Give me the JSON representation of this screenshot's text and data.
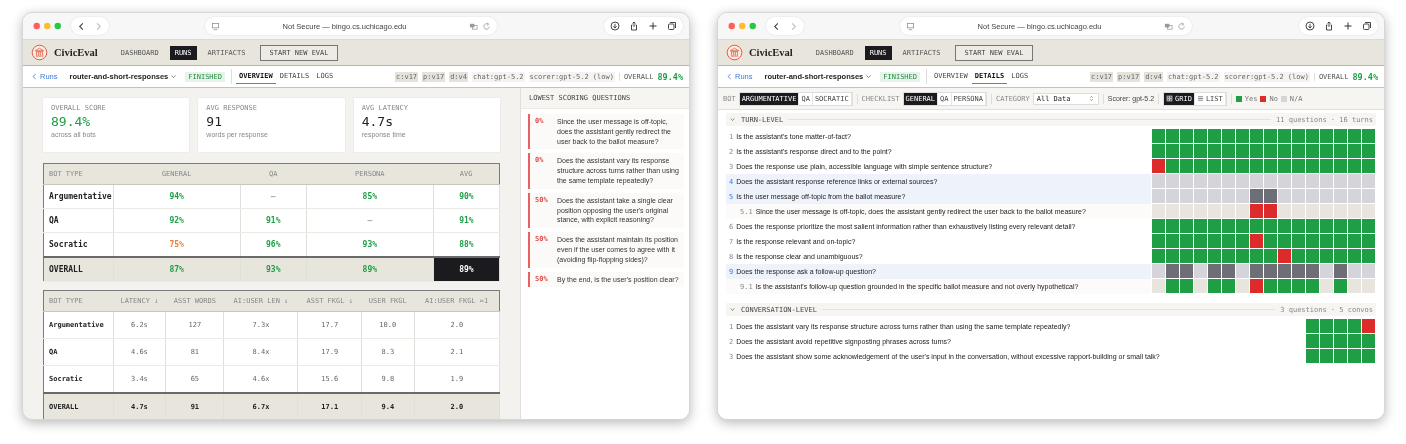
{
  "windows": [
    {
      "kind": "overview",
      "address": "Not Secure — bingo.cs.uchicago.edu",
      "logo": "CivicEval",
      "nav": [
        {
          "label": "DASHBOARD",
          "selected": false
        },
        {
          "label": "RUNS",
          "selected": true
        },
        {
          "label": "ARTIFACTS",
          "selected": false
        }
      ],
      "new_eval": "START NEW EVAL",
      "run": {
        "back": "Runs",
        "name": "router-and-short-responses",
        "status": "FINISHED",
        "tabs": [
          {
            "label": "OVERVIEW",
            "selected": true
          },
          {
            "label": "DETAILS",
            "selected": false
          },
          {
            "label": "LOGS",
            "selected": false
          }
        ],
        "tags": [
          {
            "text": "c:v17",
            "kind": "version"
          },
          {
            "text": "p:v17",
            "kind": "version"
          },
          {
            "text": "d:v4",
            "kind": "version"
          },
          {
            "text": "chat:gpt-5.2",
            "kind": "model"
          },
          {
            "text": "scorer:gpt-5.2 (low)",
            "kind": "model"
          }
        ],
        "overall_label": "OVERALL",
        "overall_value": "89.4%"
      },
      "stats": [
        {
          "label": "OVERALL SCORE",
          "value": "89.4%",
          "note": "across all bots",
          "color": "#1f9e45"
        },
        {
          "label": "AVG RESPONSE",
          "value": "91",
          "note": "words per response",
          "color": "#222222"
        },
        {
          "label": "AVG LATENCY",
          "value": "4.7s",
          "note": "response time",
          "color": "#222222"
        }
      ],
      "score_table": {
        "columns": [
          "BOT TYPE",
          "GENERAL",
          "QA",
          "PERSONA",
          "AVG"
        ],
        "rows": [
          {
            "kind": "bot",
            "cells": [
              {
                "text": "Argumentative",
                "color": "#222222",
                "highlighted": false
              },
              {
                "text": "94%",
                "color": "#1f9e45",
                "highlighted": false
              },
              {
                "text": "—",
                "color": "#aaaaaa",
                "highlighted": false
              },
              {
                "text": "85%",
                "color": "#1f9e45",
                "highlighted": false
              },
              {
                "text": "90%",
                "color": "#1f9e45",
                "highlighted": false
              }
            ]
          },
          {
            "kind": "bot",
            "cells": [
              {
                "text": "QA",
                "color": "#222222",
                "highlighted": false
              },
              {
                "text": "92%",
                "color": "#1f9e45",
                "highlighted": false
              },
              {
                "text": "91%",
                "color": "#1f9e45",
                "highlighted": false
              },
              {
                "text": "—",
                "color": "#aaaaaa",
                "highlighted": false
              },
              {
                "text": "91%",
                "color": "#1f9e45",
                "highlighted": false
              }
            ]
          },
          {
            "kind": "bot",
            "cells": [
              {
                "text": "Socratic",
                "color": "#222222",
                "highlighted": false
              },
              {
                "text": "75%",
                "color": "#e8823a",
                "highlighted": false
              },
              {
                "text": "96%",
                "color": "#1f9e45",
                "highlighted": false
              },
              {
                "text": "93%",
                "color": "#1f9e45",
                "highlighted": false
              },
              {
                "text": "88%",
                "color": "#1f9e45",
                "highlighted": false
              }
            ]
          },
          {
            "kind": "total",
            "cells": [
              {
                "text": "OVERALL",
                "color": "#222222",
                "highlighted": false
              },
              {
                "text": "87%",
                "color": "#1f9e45",
                "highlighted": false
              },
              {
                "text": "93%",
                "color": "#1f9e45",
                "highlighted": false
              },
              {
                "text": "89%",
                "color": "#1f9e45",
                "highlighted": false
              },
              {
                "text": "89%",
                "color": "#ffffff",
                "highlighted": true
              }
            ]
          }
        ]
      },
      "metrics_table": {
        "columns": [
          "BOT TYPE",
          "LATENCY ↓",
          "ASST WORDS",
          "AI:USER LEN ↓",
          "ASST FKGL ↓",
          "USER FKGL",
          "AI:USER FKGL ≈1"
        ],
        "rows": [
          {
            "kind": "bot",
            "cells": [
              "Argumentative",
              "6.2s",
              "127",
              "7.3x",
              "17.7",
              "10.0",
              "2.0"
            ]
          },
          {
            "kind": "bot",
            "cells": [
              "QA",
              "4.6s",
              "81",
              "8.4x",
              "17.9",
              "8.3",
              "2.1"
            ]
          },
          {
            "kind": "bot",
            "cells": [
              "Socratic",
              "3.4s",
              "65",
              "4.6x",
              "15.6",
              "9.8",
              "1.9"
            ]
          },
          {
            "kind": "total",
            "cells": [
              "OVERALL",
              "4.7s",
              "91",
              "6.7x",
              "17.1",
              "9.4",
              "2.0"
            ]
          }
        ]
      },
      "lowest": {
        "title": "LOWEST SCORING QUESTIONS",
        "items": [
          {
            "score": "0%",
            "text": "Since the user message is off-topic, does the assistant gently redirect the user back to the ballot measure?"
          },
          {
            "score": "0%",
            "text": "Does the assistant vary its response structure across turns rather than using the same template repeatedly?"
          },
          {
            "score": "50%",
            "text": "Does the assistant take a single clear position opposing the user's original stance, with explicit reasoning?"
          },
          {
            "score": "50%",
            "text": "Does the assistant maintain its position even if the user comes to agree with it (avoiding flip-flopping sides)?"
          },
          {
            "score": "50%",
            "text": "By the end, is the user's position clear?"
          }
        ]
      }
    },
    {
      "kind": "details",
      "address": "Not Secure — bingo.cs.uchicago.edu",
      "logo": "CivicEval",
      "nav": [
        {
          "label": "DASHBOARD",
          "selected": false
        },
        {
          "label": "RUNS",
          "selected": true
        },
        {
          "label": "ARTIFACTS",
          "selected": false
        }
      ],
      "new_eval": "START NEW EVAL",
      "run": {
        "back": "Runs",
        "name": "router-and-short-responses",
        "status": "FINISHED",
        "tabs": [
          {
            "label": "OVERVIEW",
            "selected": false
          },
          {
            "label": "DETAILS",
            "selected": true
          },
          {
            "label": "LOGS",
            "selected": false
          }
        ],
        "tags": [
          {
            "text": "c:v17",
            "kind": "version"
          },
          {
            "text": "p:v17",
            "kind": "version"
          },
          {
            "text": "d:v4",
            "kind": "version"
          },
          {
            "text": "chat:gpt-5.2",
            "kind": "model"
          },
          {
            "text": "scorer:gpt-5.2 (low)",
            "kind": "model"
          }
        ],
        "overall_label": "OVERALL",
        "overall_value": "89.4%"
      },
      "filters": {
        "groups": [
          {
            "label": "BOT",
            "options": [
              {
                "label": "ARGUMENTATIVE",
                "selected": true
              },
              {
                "label": "QA",
                "selected": false
              },
              {
                "label": "SOCRATIC",
                "selected": false
              }
            ]
          },
          {
            "label": "CHECKLIST",
            "options": [
              {
                "label": "GENERAL",
                "selected": true
              },
              {
                "label": "QA",
                "selected": false
              },
              {
                "label": "PERSONA",
                "selected": false
              }
            ]
          }
        ],
        "category": {
          "label": "CATEGORY",
          "value": "All Data"
        },
        "scorer": "Scorer: gpt-5.2",
        "views": [
          {
            "label": "GRID",
            "kind": "grid",
            "selected": true
          },
          {
            "label": "LIST",
            "kind": "list",
            "selected": false
          }
        ],
        "legend": [
          {
            "label": "Yes",
            "color": "#1f9e45"
          },
          {
            "label": "No",
            "color": "#dd2b2b"
          },
          {
            "label": "N/A",
            "color": "#d4d4da"
          }
        ]
      },
      "sections": [
        {
          "title": "TURN-LEVEL",
          "summary": "11 questions · 16 turns",
          "expanded": true,
          "questions": [
            {
              "number": "1",
              "text": "Is the assistant's tone matter-of-fact?",
              "highlighted": false,
              "cells": [
                {
                  "color": "#1f9e45"
                },
                {
                  "color": "#1f9e45"
                },
                {
                  "color": "#1f9e45"
                },
                {
                  "color": "#1f9e45"
                },
                {
                  "color": "#1f9e45"
                },
                {
                  "color": "#1f9e45"
                },
                {
                  "color": "#1f9e45"
                },
                {
                  "color": "#1f9e45"
                },
                {
                  "color": "#1f9e45"
                },
                {
                  "color": "#1f9e45"
                },
                {
                  "color": "#1f9e45"
                },
                {
                  "color": "#1f9e45"
                },
                {
                  "color": "#1f9e45"
                },
                {
                  "color": "#1f9e45"
                },
                {
                  "color": "#1f9e45"
                },
                {
                  "color": "#1f9e45"
                }
              ]
            },
            {
              "number": "2",
              "text": "Is the assistant's response direct and to the point?",
              "highlighted": false,
              "cells": [
                {
                  "color": "#1f9e45"
                },
                {
                  "color": "#1f9e45"
                },
                {
                  "color": "#1f9e45"
                },
                {
                  "color": "#1f9e45"
                },
                {
                  "color": "#1f9e45"
                },
                {
                  "color": "#1f9e45"
                },
                {
                  "color": "#1f9e45"
                },
                {
                  "color": "#1f9e45"
                },
                {
                  "color": "#1f9e45"
                },
                {
                  "color": "#1f9e45"
                },
                {
                  "color": "#1f9e45"
                },
                {
                  "color": "#1f9e45"
                },
                {
                  "color": "#1f9e45"
                },
                {
                  "color": "#1f9e45"
                },
                {
                  "color": "#1f9e45"
                },
                {
                  "color": "#1f9e45"
                }
              ]
            },
            {
              "number": "3",
              "text": "Does the response use plain, accessible language with simple sentence structure?",
              "highlighted": false,
              "cells": [
                {
                  "color": "#dd2b2b"
                },
                {
                  "color": "#1f9e45"
                },
                {
                  "color": "#1f9e45"
                },
                {
                  "color": "#1f9e45"
                },
                {
                  "color": "#1f9e45"
                },
                {
                  "color": "#1f9e45"
                },
                {
                  "color": "#1f9e45"
                },
                {
                  "color": "#1f9e45"
                },
                {
                  "color": "#1f9e45"
                },
                {
                  "color": "#1f9e45"
                },
                {
                  "color": "#1f9e45"
                },
                {
                  "color": "#1f9e45"
                },
                {
                  "color": "#1f9e45"
                },
                {
                  "color": "#1f9e45"
                },
                {
                  "color": "#1f9e45"
                },
                {
                  "color": "#1f9e45"
                }
              ]
            },
            {
              "number": "4",
              "text": "Does the assistant response reference links or external sources?",
              "highlighted": true,
              "cells": [
                {
                  "color": "#d4d4da"
                },
                {
                  "color": "#d4d4da"
                },
                {
                  "color": "#d4d4da"
                },
                {
                  "color": "#d4d4da"
                },
                {
                  "color": "#d4d4da"
                },
                {
                  "color": "#d4d4da"
                },
                {
                  "color": "#d4d4da"
                },
                {
                  "color": "#d4d4da"
                },
                {
                  "color": "#d4d4da"
                },
                {
                  "color": "#d4d4da"
                },
                {
                  "color": "#d4d4da"
                },
                {
                  "color": "#d4d4da"
                },
                {
                  "color": "#d4d4da"
                },
                {
                  "color": "#d4d4da"
                },
                {
                  "color": "#d4d4da"
                },
                {
                  "color": "#d4d4da"
                }
              ]
            },
            {
              "number": "5",
              "text": "Is the user message off-topic from the ballot measure?",
              "highlighted": true,
              "cells": [
                {
                  "color": "#d4d4da"
                },
                {
                  "color": "#d4d4da"
                },
                {
                  "color": "#d4d4da"
                },
                {
                  "color": "#d4d4da"
                },
                {
                  "color": "#d4d4da"
                },
                {
                  "color": "#d4d4da"
                },
                {
                  "color": "#d4d4da"
                },
                {
                  "color": "#6e6e77"
                },
                {
                  "color": "#6e6e77"
                },
                {
                  "color": "#d4d4da"
                },
                {
                  "color": "#d4d4da"
                },
                {
                  "color": "#d4d4da"
                },
                {
                  "color": "#d4d4da"
                },
                {
                  "color": "#d4d4da"
                },
                {
                  "color": "#d4d4da"
                },
                {
                  "color": "#d4d4da"
                }
              ],
              "children": [
                {
                  "number": "5.1",
                  "text": "Since the user message is off-topic, does the assistant gently redirect the user back to the ballot measure?",
                  "highlighted": false,
                  "cells": [
                    {
                      "color": "#e8e5de"
                    },
                    {
                      "color": "#e8e5de"
                    },
                    {
                      "color": "#e8e5de"
                    },
                    {
                      "color": "#e8e5de"
                    },
                    {
                      "color": "#e8e5de"
                    },
                    {
                      "color": "#e8e5de"
                    },
                    {
                      "color": "#e8e5de"
                    },
                    {
                      "color": "#dd2b2b"
                    },
                    {
                      "color": "#dd2b2b"
                    },
                    {
                      "color": "#e8e5de"
                    },
                    {
                      "color": "#e8e5de"
                    },
                    {
                      "color": "#e8e5de"
                    },
                    {
                      "color": "#e8e5de"
                    },
                    {
                      "color": "#e8e5de"
                    },
                    {
                      "color": "#e8e5de"
                    },
                    {
                      "color": "#e8e5de"
                    }
                  ]
                }
              ]
            },
            {
              "number": "6",
              "text": "Does the response prioritize the most salient information rather than exhaustively listing every relevant detail?",
              "highlighted": false,
              "cells": [
                {
                  "color": "#1f9e45"
                },
                {
                  "color": "#1f9e45"
                },
                {
                  "color": "#1f9e45"
                },
                {
                  "color": "#1f9e45"
                },
                {
                  "color": "#1f9e45"
                },
                {
                  "color": "#1f9e45"
                },
                {
                  "color": "#1f9e45"
                },
                {
                  "color": "#1f9e45"
                },
                {
                  "color": "#1f9e45"
                },
                {
                  "color": "#1f9e45"
                },
                {
                  "color": "#1f9e45"
                },
                {
                  "color": "#1f9e45"
                },
                {
                  "color": "#1f9e45"
                },
                {
                  "color": "#1f9e45"
                },
                {
                  "color": "#1f9e45"
                },
                {
                  "color": "#1f9e45"
                }
              ]
            },
            {
              "number": "7",
              "text": "Is the response relevant and on-topic?",
              "highlighted": false,
              "cells": [
                {
                  "color": "#1f9e45"
                },
                {
                  "color": "#1f9e45"
                },
                {
                  "color": "#1f9e45"
                },
                {
                  "color": "#1f9e45"
                },
                {
                  "color": "#1f9e45"
                },
                {
                  "color": "#1f9e45"
                },
                {
                  "color": "#1f9e45"
                },
                {
                  "color": "#dd2b2b"
                },
                {
                  "color": "#1f9e45"
                },
                {
                  "color": "#1f9e45"
                },
                {
                  "color": "#1f9e45"
                },
                {
                  "color": "#1f9e45"
                },
                {
                  "color": "#1f9e45"
                },
                {
                  "color": "#1f9e45"
                },
                {
                  "color": "#1f9e45"
                },
                {
                  "color": "#1f9e45"
                }
              ]
            },
            {
              "number": "8",
              "text": "Is the response clear and unambiguous?",
              "highlighted": false,
              "cells": [
                {
                  "color": "#1f9e45"
                },
                {
                  "color": "#1f9e45"
                },
                {
                  "color": "#1f9e45"
                },
                {
                  "color": "#1f9e45"
                },
                {
                  "color": "#1f9e45"
                },
                {
                  "color": "#1f9e45"
                },
                {
                  "color": "#1f9e45"
                },
                {
                  "color": "#1f9e45"
                },
                {
                  "color": "#1f9e45"
                },
                {
                  "color": "#dd2b2b"
                },
                {
                  "color": "#1f9e45"
                },
                {
                  "color": "#1f9e45"
                },
                {
                  "color": "#1f9e45"
                },
                {
                  "color": "#1f9e45"
                },
                {
                  "color": "#1f9e45"
                },
                {
                  "color": "#1f9e45"
                }
              ]
            },
            {
              "number": "9",
              "text": "Does the response ask a follow-up question?",
              "highlighted": true,
              "cells": [
                {
                  "color": "#d4d4da"
                },
                {
                  "color": "#6e6e77"
                },
                {
                  "color": "#6e6e77"
                },
                {
                  "color": "#d4d4da"
                },
                {
                  "color": "#6e6e77"
                },
                {
                  "color": "#6e6e77"
                },
                {
                  "color": "#d4d4da"
                },
                {
                  "color": "#6e6e77"
                },
                {
                  "color": "#6e6e77"
                },
                {
                  "color": "#6e6e77"
                },
                {
                  "color": "#6e6e77"
                },
                {
                  "color": "#6e6e77"
                },
                {
                  "color": "#d4d4da"
                },
                {
                  "color": "#6e6e77"
                },
                {
                  "color": "#d4d4da"
                },
                {
                  "color": "#d4d4da"
                }
              ],
              "children": [
                {
                  "number": "9.1",
                  "text": "Is the assistant's follow-up question grounded in the specific ballot measure and not overly hypothetical?",
                  "highlighted": false,
                  "cells": [
                    {
                      "color": "#e8e5de"
                    },
                    {
                      "color": "#1f9e45"
                    },
                    {
                      "color": "#1f9e45"
                    },
                    {
                      "color": "#e8e5de"
                    },
                    {
                      "color": "#1f9e45"
                    },
                    {
                      "color": "#1f9e45"
                    },
                    {
                      "color": "#e8e5de"
                    },
                    {
                      "color": "#dd2b2b"
                    },
                    {
                      "color": "#1f9e45"
                    },
                    {
                      "color": "#1f9e45"
                    },
                    {
                      "color": "#1f9e45"
                    },
                    {
                      "color": "#1f9e45"
                    },
                    {
                      "color": "#e8e5de"
                    },
                    {
                      "color": "#1f9e45"
                    },
                    {
                      "color": "#e8e5de"
                    },
                    {
                      "color": "#e8e5de"
                    }
                  ]
                }
              ]
            }
          ]
        },
        {
          "title": "CONVERSATION-LEVEL",
          "summary": "3 questions · 5 convos",
          "expanded": true,
          "questions": [
            {
              "number": "1",
              "text": "Does the assistant vary its response structure across turns rather than using the same template repeatedly?",
              "highlighted": false,
              "cells": [
                {
                  "color": "#1f9e45"
                },
                {
                  "color": "#1f9e45"
                },
                {
                  "color": "#1f9e45"
                },
                {
                  "color": "#1f9e45"
                },
                {
                  "color": "#dd2b2b"
                }
              ]
            },
            {
              "number": "2",
              "text": "Does the assistant avoid repetitive signposting phrases across turns?",
              "highlighted": false,
              "cells": [
                {
                  "color": "#1f9e45"
                },
                {
                  "color": "#1f9e45"
                },
                {
                  "color": "#1f9e45"
                },
                {
                  "color": "#1f9e45"
                },
                {
                  "color": "#1f9e45"
                }
              ]
            },
            {
              "number": "3",
              "text": "Does the assistant show some acknowledgement of the user's input in the conversation, without excessive rapport-building or small talk?",
              "highlighted": false,
              "cells": [
                {
                  "color": "#1f9e45"
                },
                {
                  "color": "#1f9e45"
                },
                {
                  "color": "#1f9e45"
                },
                {
                  "color": "#1f9e45"
                },
                {
                  "color": "#1f9e45"
                }
              ]
            }
          ]
        }
      ]
    }
  ]
}
